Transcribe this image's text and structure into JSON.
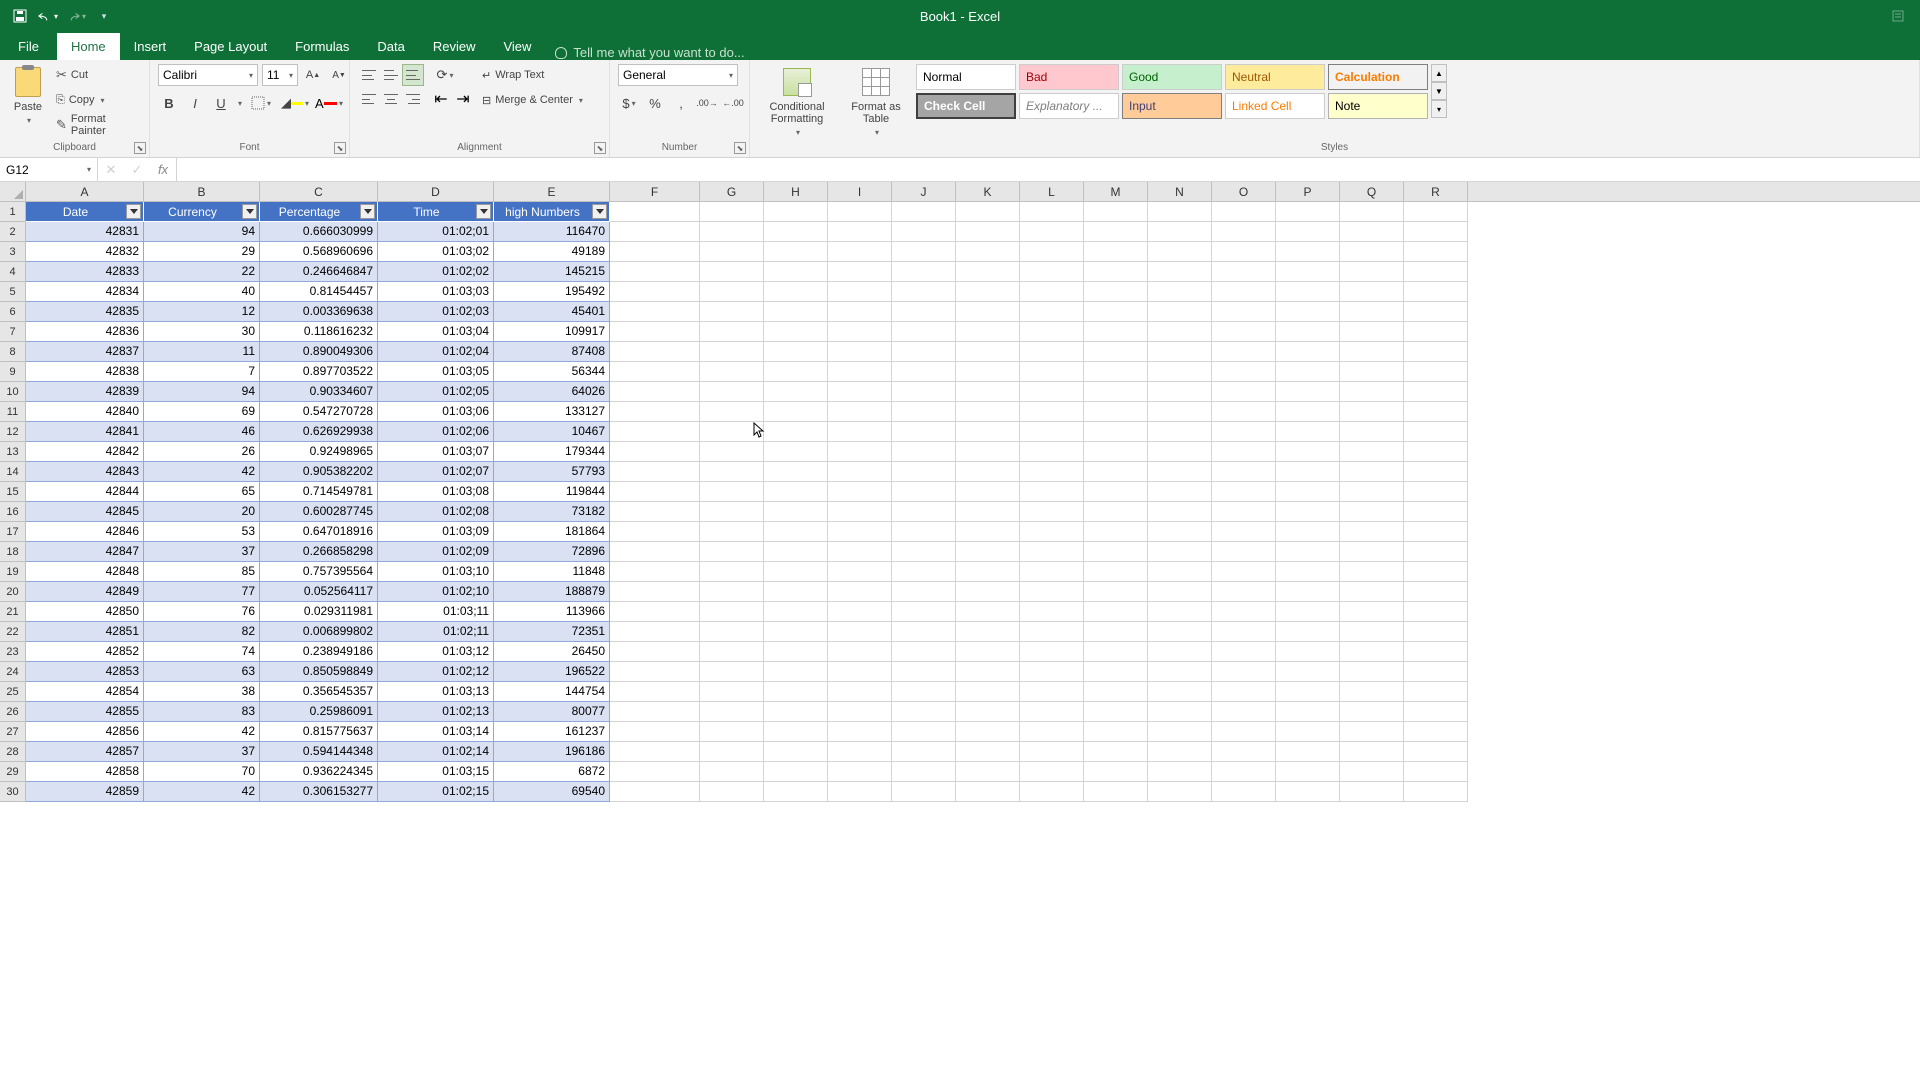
{
  "app": {
    "title": "Book1 - Excel"
  },
  "tabs": {
    "file": "File",
    "home": "Home",
    "insert": "Insert",
    "pageLayout": "Page Layout",
    "formulas": "Formulas",
    "data": "Data",
    "review": "Review",
    "view": "View",
    "tellme": "Tell me what you want to do..."
  },
  "clipboard": {
    "paste": "Paste",
    "cut": "Cut",
    "copy": "Copy",
    "formatPainter": "Format Painter",
    "label": "Clipboard"
  },
  "font": {
    "name": "Calibri",
    "size": "11",
    "label": "Font"
  },
  "alignment": {
    "wrap": "Wrap Text",
    "merge": "Merge & Center",
    "label": "Alignment"
  },
  "number": {
    "format": "General",
    "label": "Number"
  },
  "styles": {
    "conditional": "Conditional Formatting",
    "formatAs": "Format as Table",
    "normal": "Normal",
    "bad": "Bad",
    "good": "Good",
    "neutral": "Neutral",
    "calculation": "Calculation",
    "check": "Check Cell",
    "explanatory": "Explanatory ...",
    "input": "Input",
    "linked": "Linked Cell",
    "note": "Note",
    "label": "Styles"
  },
  "nameBox": "G12",
  "columns": [
    "A",
    "B",
    "C",
    "D",
    "E",
    "F",
    "G",
    "H",
    "I",
    "J",
    "K",
    "L",
    "M",
    "N",
    "O",
    "P",
    "Q",
    "R"
  ],
  "tableHeaders": [
    "Date",
    "Currency",
    "Percentage",
    "Time",
    "high Numbers"
  ],
  "tableRows": [
    {
      "n": 2,
      "a": "42831",
      "b": "94",
      "c": "0.666030999",
      "d": "01:02;01",
      "e": "116470"
    },
    {
      "n": 3,
      "a": "42832",
      "b": "29",
      "c": "0.568960696",
      "d": "01:03;02",
      "e": "49189"
    },
    {
      "n": 4,
      "a": "42833",
      "b": "22",
      "c": "0.246646847",
      "d": "01:02;02",
      "e": "145215"
    },
    {
      "n": 5,
      "a": "42834",
      "b": "40",
      "c": "0.81454457",
      "d": "01:03;03",
      "e": "195492"
    },
    {
      "n": 6,
      "a": "42835",
      "b": "12",
      "c": "0.003369638",
      "d": "01:02;03",
      "e": "45401"
    },
    {
      "n": 7,
      "a": "42836",
      "b": "30",
      "c": "0.118616232",
      "d": "01:03;04",
      "e": "109917"
    },
    {
      "n": 8,
      "a": "42837",
      "b": "11",
      "c": "0.890049306",
      "d": "01:02;04",
      "e": "87408"
    },
    {
      "n": 9,
      "a": "42838",
      "b": "7",
      "c": "0.897703522",
      "d": "01:03;05",
      "e": "56344"
    },
    {
      "n": 10,
      "a": "42839",
      "b": "94",
      "c": "0.90334607",
      "d": "01:02;05",
      "e": "64026"
    },
    {
      "n": 11,
      "a": "42840",
      "b": "69",
      "c": "0.547270728",
      "d": "01:03;06",
      "e": "133127"
    },
    {
      "n": 12,
      "a": "42841",
      "b": "46",
      "c": "0.626929938",
      "d": "01:02;06",
      "e": "10467"
    },
    {
      "n": 13,
      "a": "42842",
      "b": "26",
      "c": "0.92498965",
      "d": "01:03;07",
      "e": "179344"
    },
    {
      "n": 14,
      "a": "42843",
      "b": "42",
      "c": "0.905382202",
      "d": "01:02;07",
      "e": "57793"
    },
    {
      "n": 15,
      "a": "42844",
      "b": "65",
      "c": "0.714549781",
      "d": "01:03;08",
      "e": "119844"
    },
    {
      "n": 16,
      "a": "42845",
      "b": "20",
      "c": "0.600287745",
      "d": "01:02;08",
      "e": "73182"
    },
    {
      "n": 17,
      "a": "42846",
      "b": "53",
      "c": "0.647018916",
      "d": "01:03;09",
      "e": "181864"
    },
    {
      "n": 18,
      "a": "42847",
      "b": "37",
      "c": "0.266858298",
      "d": "01:02;09",
      "e": "72896"
    },
    {
      "n": 19,
      "a": "42848",
      "b": "85",
      "c": "0.757395564",
      "d": "01:03;10",
      "e": "11848"
    },
    {
      "n": 20,
      "a": "42849",
      "b": "77",
      "c": "0.052564117",
      "d": "01:02;10",
      "e": "188879"
    },
    {
      "n": 21,
      "a": "42850",
      "b": "76",
      "c": "0.029311981",
      "d": "01:03;11",
      "e": "113966"
    },
    {
      "n": 22,
      "a": "42851",
      "b": "82",
      "c": "0.006899802",
      "d": "01:02;11",
      "e": "72351"
    },
    {
      "n": 23,
      "a": "42852",
      "b": "74",
      "c": "0.238949186",
      "d": "01:03;12",
      "e": "26450"
    },
    {
      "n": 24,
      "a": "42853",
      "b": "63",
      "c": "0.850598849",
      "d": "01:02;12",
      "e": "196522"
    },
    {
      "n": 25,
      "a": "42854",
      "b": "38",
      "c": "0.356545357",
      "d": "01:03;13",
      "e": "144754"
    },
    {
      "n": 26,
      "a": "42855",
      "b": "83",
      "c": "0.25986091",
      "d": "01:02;13",
      "e": "80077"
    },
    {
      "n": 27,
      "a": "42856",
      "b": "42",
      "c": "0.815775637",
      "d": "01:03;14",
      "e": "161237"
    },
    {
      "n": 28,
      "a": "42857",
      "b": "37",
      "c": "0.594144348",
      "d": "01:02;14",
      "e": "196186"
    },
    {
      "n": 29,
      "a": "42858",
      "b": "70",
      "c": "0.936224345",
      "d": "01:03;15",
      "e": "6872"
    },
    {
      "n": 30,
      "a": "42859",
      "b": "42",
      "c": "0.306153277",
      "d": "01:02;15",
      "e": "69540"
    }
  ]
}
